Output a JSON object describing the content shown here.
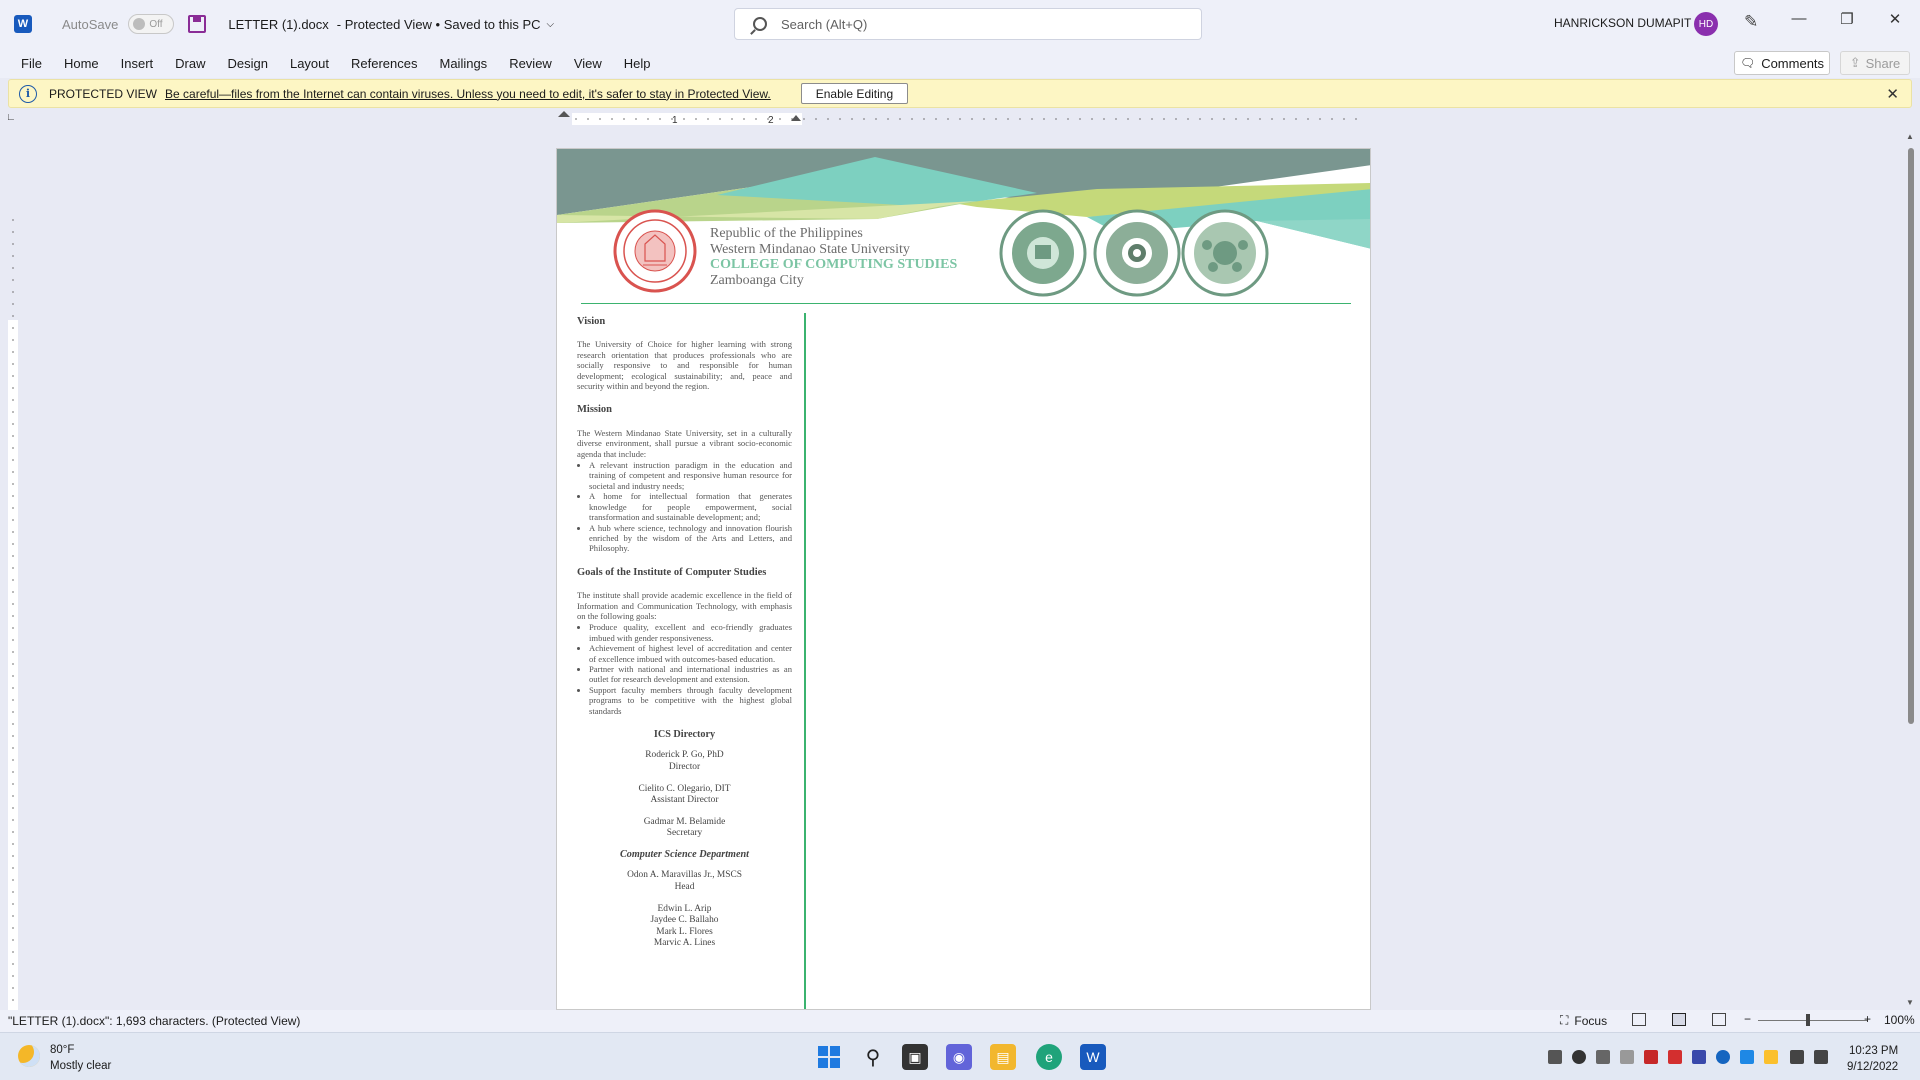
{
  "titlebar": {
    "app_logo": "W",
    "autosave_label": "AutoSave",
    "autosave_state": "Off",
    "doc_name": "LETTER (1).docx",
    "doc_status": "-  Protected View • Saved to this PC",
    "search_placeholder": "Search (Alt+Q)",
    "user_name": "HANRICKSON DUMAPIT",
    "user_initials": "HD"
  },
  "menu": {
    "tabs": [
      "File",
      "Home",
      "Insert",
      "Draw",
      "Design",
      "Layout",
      "References",
      "Mailings",
      "Review",
      "View",
      "Help"
    ],
    "comments_label": "Comments",
    "share_label": "Share"
  },
  "protected_bar": {
    "label": "PROTECTED VIEW",
    "message": "Be careful—files from the Internet can contain viruses. Unless you need to edit, it's safer to stay in Protected View.",
    "enable_label": "Enable Editing"
  },
  "ruler": {
    "marks": [
      "1",
      "2"
    ]
  },
  "document": {
    "header": {
      "line1": "Republic of the Philippines",
      "line2": "Western Mindanao State University",
      "line3": "COLLEGE OF COMPUTING STUDIES",
      "line4": "Zamboanga City",
      "seal_text": "WESTERN MINDANAO STATE UNIVERSITY",
      "logo1_text": "COLLEGE OF COMPUTING STUDIES • WMSU",
      "logo2_text": "DEPARTMENT OF COMPUTER SCIENCE",
      "logo3_text": "DEPARTMENT OF INFORMATION TECHNOLOGY"
    },
    "vision_title": "Vision",
    "vision_text": "The University of Choice for higher learning with strong research orientation that produces professionals who are socially responsive to and responsible for human development; ecological sustainability; and, peace and security within and beyond the region.",
    "mission_title": "Mission",
    "mission_text": "The Western Mindanao State University, set in a culturally diverse environment, shall pursue a vibrant socio-economic agenda that include:",
    "mission_items": [
      "A relevant instruction paradigm in the education and training of competent and responsive human resource for societal and industry needs;",
      "A home for intellectual formation that generates knowledge for people empowerment, social transformation and sustainable development; and;",
      "A hub where science, technology and innovation flourish enriched by the wisdom of the Arts and Letters, and Philosophy."
    ],
    "goals_title": "Goals of the Institute of Computer Studies",
    "goals_text": "The institute shall provide academic excellence in the field of Information and Communication Technology, with emphasis on the following goals:",
    "goals_items": [
      "Produce quality, excellent and eco-friendly graduates imbued with gender responsiveness.",
      "Achievement of highest level of accreditation and center of excellence imbued with outcomes-based education.",
      "Partner with national and international industries as an outlet for research development and extension.",
      "Support faculty members through faculty development programs to be competitive with the highest global standards"
    ],
    "directory_title": "ICS Directory",
    "directory": [
      {
        "name": "Roderick P. Go, PhD",
        "role": "Director"
      },
      {
        "name": "Cielito C. Olegario, DIT",
        "role": "Assistant Director"
      },
      {
        "name": "Gadmar M. Belamide",
        "role": "Secretary"
      }
    ],
    "cs_dept_title": "Computer Science Department",
    "cs_head": {
      "name": "Odon A. Maravillas Jr., MSCS",
      "role": "Head"
    },
    "cs_faculty": [
      "Edwin L. Arip",
      "Jaydee C. Ballaho",
      "Mark L. Flores",
      "Marvic A. Lines"
    ]
  },
  "statusbar": {
    "info": "\"LETTER (1).docx\": 1,693 characters.  (Protected View)",
    "focus_label": "Focus",
    "zoom": "100%"
  },
  "taskbar": {
    "temperature": "80°F",
    "weather": "Mostly clear",
    "time": "10:23 PM",
    "date": "9/12/2022"
  },
  "colors": {
    "accent_green": "#3bb36f",
    "teal": "#7dd0c0",
    "lime": "#c5d97a",
    "header_gray": "#7a9690",
    "seal_red": "#d9534f",
    "avatar_purple": "#8a2fae",
    "protected_yellow": "#fdf6c4"
  }
}
